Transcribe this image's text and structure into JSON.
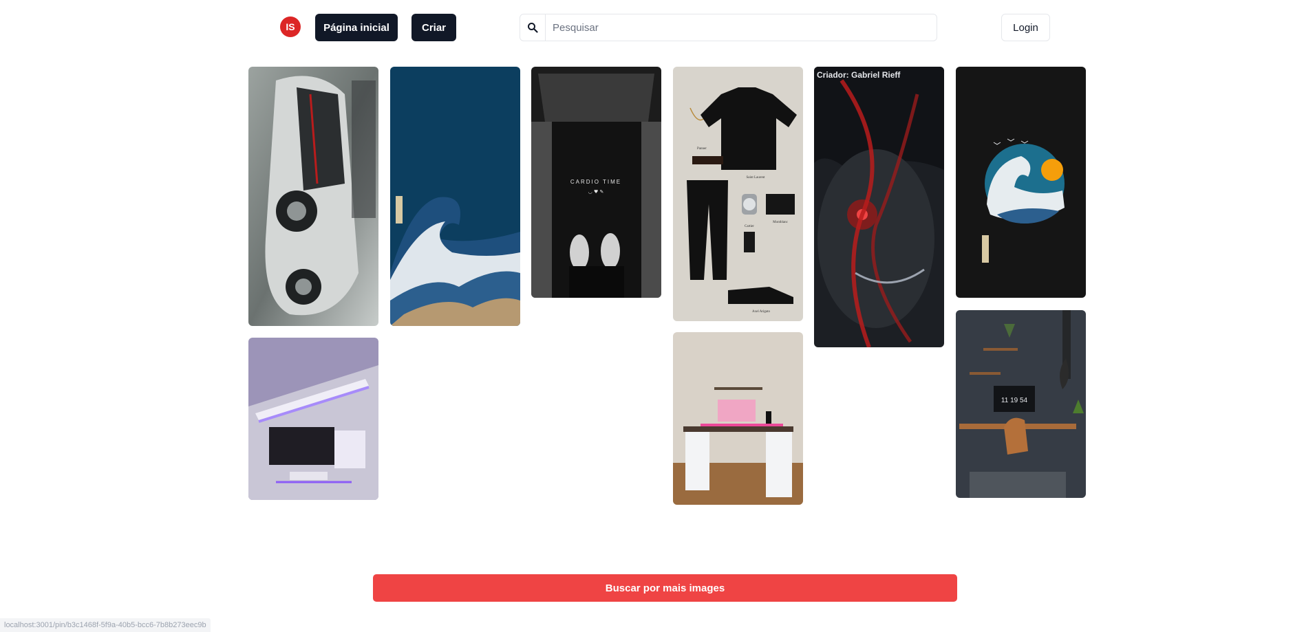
{
  "header": {
    "logo_text": "IS",
    "nav_home": "Página inicial",
    "nav_create": "Criar",
    "search_placeholder": "Pesquisar",
    "search_icon": "search-icon",
    "login": "Login"
  },
  "pins": [
    {
      "name": "pin-car"
    },
    {
      "name": "pin-great-wave"
    },
    {
      "name": "pin-treadmill",
      "caption": "CARDIO TIME",
      "sub": "◡ ♥ ✎"
    },
    {
      "name": "pin-outfit",
      "labels": [
        "Panner",
        "Saint Laurent",
        "Cartier",
        "Montblanc",
        "Axel Arigato"
      ]
    },
    {
      "name": "pin-anime",
      "credit": "Criador: Gabriel Rieff"
    },
    {
      "name": "pin-wave-circle"
    },
    {
      "name": "pin-purple-setup"
    },
    {
      "name": "pin-pink-desk"
    },
    {
      "name": "pin-dark-office",
      "clock": "11 19 54"
    }
  ],
  "more_button": "Buscar por mais images",
  "status_url": "localhost:3001/pin/b3c1468f-5f9a-40b5-bcc6-7b8b273eec9b"
}
